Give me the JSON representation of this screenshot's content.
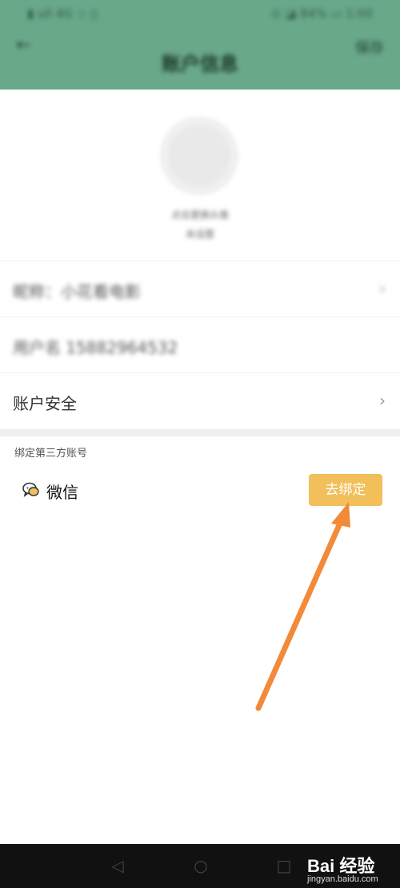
{
  "status_bar": {
    "left": "▮ ull 4G ☆ ▯",
    "right": "⊙ ◪ 84% ▭ 1:00"
  },
  "header": {
    "title": "账户信息",
    "back_icon": "back-arrow-icon",
    "action": "保存"
  },
  "profile": {
    "nickname": "点击更换头像",
    "subtitle": "未设置"
  },
  "rows": [
    {
      "label": "昵称：小花看电影",
      "blurred": true
    },
    {
      "label": "用户名 15882964532",
      "blurred": true
    },
    {
      "label": "账户安全",
      "blurred": false
    }
  ],
  "third_party": {
    "section_title": "绑定第三方账号",
    "items": [
      {
        "label": "微信",
        "icon": "wechat-icon",
        "action": "去绑定"
      }
    ]
  },
  "annotation": {
    "type": "arrow",
    "color": "#f28a3a"
  },
  "nav_bar": {
    "buttons": [
      "◁",
      "○",
      "□"
    ]
  },
  "watermark": {
    "brand": "Bai  经验",
    "url": "jingyan.baidu.com"
  },
  "colors": {
    "header": "#6aa88a",
    "bind_button": "#f2bf5b",
    "arrow": "#f28a3a"
  }
}
